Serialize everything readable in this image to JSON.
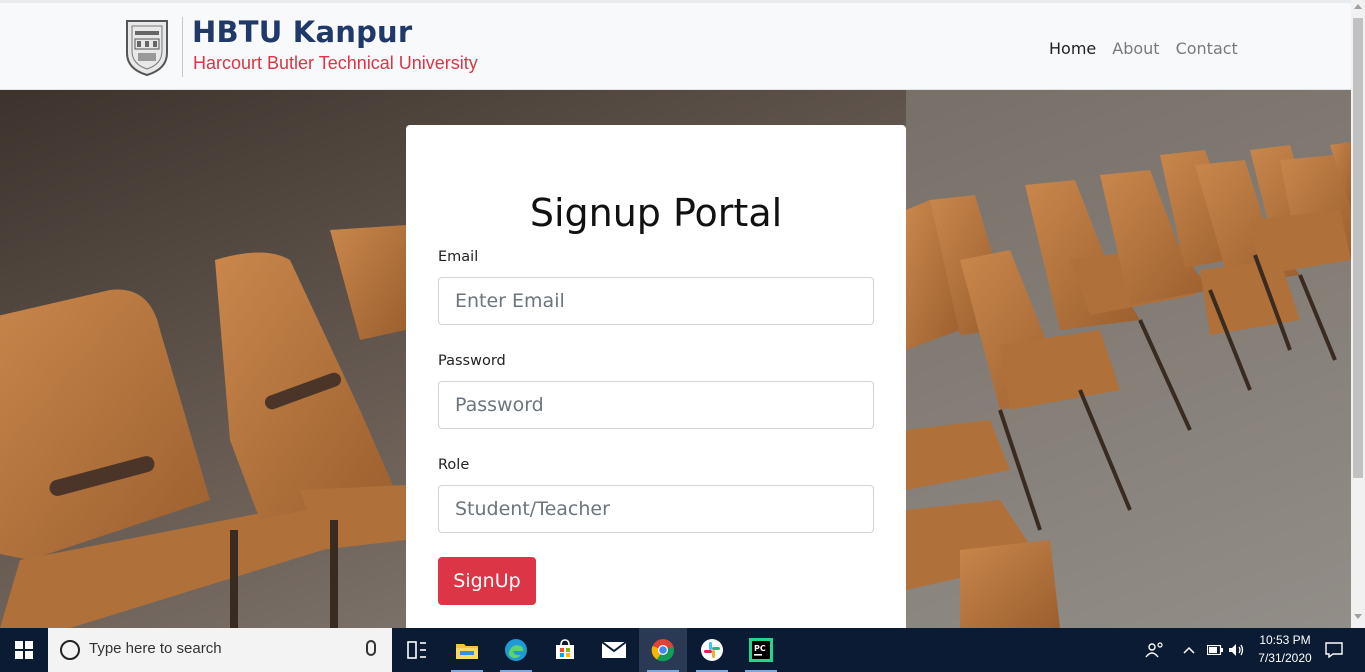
{
  "header": {
    "brand_title": "HBTU Kanpur",
    "brand_subtitle": "Harcourt Butler Technical  University",
    "nav": [
      {
        "label": "Home",
        "active": true
      },
      {
        "label": "About",
        "active": false
      },
      {
        "label": "Contact",
        "active": false
      }
    ]
  },
  "form": {
    "title": "Signup Portal",
    "email_label": "Email",
    "email_placeholder": "Enter Email",
    "password_label": "Password",
    "password_placeholder": "Password",
    "role_label": "Role",
    "role_placeholder": "Student/Teacher",
    "submit_label": "SignUp"
  },
  "taskbar": {
    "search_placeholder": "Type here to search",
    "time": "10:53 PM",
    "date": "7/31/2020",
    "apps": [
      "task-view",
      "file-explorer",
      "edge",
      "store",
      "mail",
      "chrome",
      "slack",
      "pycharm"
    ]
  },
  "colors": {
    "brand_blue": "#1f3a68",
    "accent_red": "#dc3545",
    "taskbar_bg": "#0b1b33"
  }
}
